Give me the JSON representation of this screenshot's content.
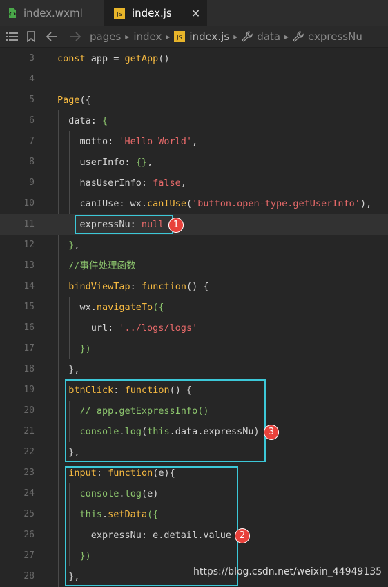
{
  "tabs": [
    {
      "label": "index.wxml",
      "icon": "wxml-file-icon"
    },
    {
      "label": "index.js",
      "icon": "js-file-icon"
    }
  ],
  "breadcrumb": [
    "pages",
    "index",
    "index.js",
    "data",
    "expressNu"
  ],
  "js_badge": "JS",
  "lines": [
    {
      "num": "3",
      "text": "const app = getApp()"
    },
    {
      "num": "4",
      "text": ""
    },
    {
      "num": "5",
      "text": "Page({"
    },
    {
      "num": "6",
      "text": "  data: {"
    },
    {
      "num": "7",
      "text": "    motto: 'Hello World',"
    },
    {
      "num": "8",
      "text": "    userInfo: {},"
    },
    {
      "num": "9",
      "text": "    hasUserInfo: false,"
    },
    {
      "num": "10",
      "text": "    canIUse: wx.canIUse('button.open-type.getUserInfo'),"
    },
    {
      "num": "11",
      "text": "    expressNu: null"
    },
    {
      "num": "12",
      "text": "  },"
    },
    {
      "num": "13",
      "text": "  //事件处理函数"
    },
    {
      "num": "14",
      "text": "  bindViewTap: function() {"
    },
    {
      "num": "15",
      "text": "    wx.navigateTo({"
    },
    {
      "num": "16",
      "text": "      url: '../logs/logs'"
    },
    {
      "num": "17",
      "text": "    })"
    },
    {
      "num": "18",
      "text": "  },"
    },
    {
      "num": "19",
      "text": "  btnClick: function() {"
    },
    {
      "num": "20",
      "text": "    // app.getExpressInfo()"
    },
    {
      "num": "21",
      "text": "    console.log(this.data.expressNu)"
    },
    {
      "num": "22",
      "text": "  },"
    },
    {
      "num": "23",
      "text": "  input: function(e){"
    },
    {
      "num": "24",
      "text": "    console.log(e)"
    },
    {
      "num": "25",
      "text": "    this.setData({"
    },
    {
      "num": "26",
      "text": "      expressNu: e.detail.value"
    },
    {
      "num": "27",
      "text": "    })"
    },
    {
      "num": "28",
      "text": "  },"
    }
  ],
  "badges": [
    "1",
    "2",
    "3"
  ],
  "watermark": "https://blog.csdn.net/weixin_44949135",
  "colors": {
    "highlight_box": "#3cc8d8",
    "badge": "#e8413b",
    "keyword": "#f5b941",
    "string": "#e86a6a",
    "comment": "#8cc46d"
  }
}
